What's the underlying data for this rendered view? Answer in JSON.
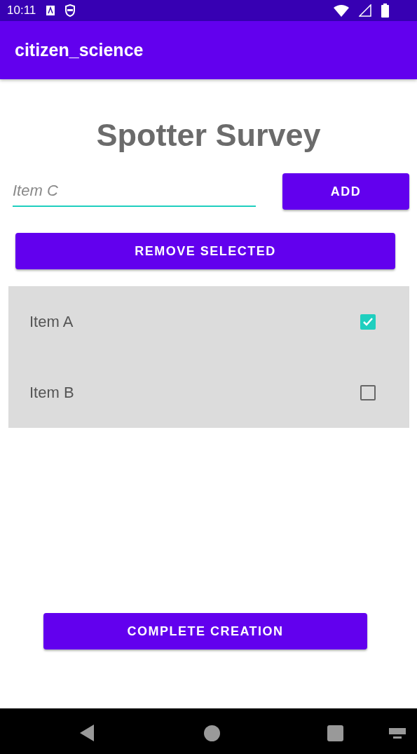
{
  "status_bar": {
    "time": "10:11"
  },
  "app_bar": {
    "title": "citizen_science"
  },
  "heading": "Spotter Survey",
  "item_field": {
    "placeholder": "Item C"
  },
  "add_button": "ADD",
  "remove_button": "REMOVE SELECTED",
  "items": [
    {
      "label": "Item A",
      "checked": true
    },
    {
      "label": "Item B",
      "checked": false
    }
  ],
  "complete_button": "COMPLETE CREATION"
}
